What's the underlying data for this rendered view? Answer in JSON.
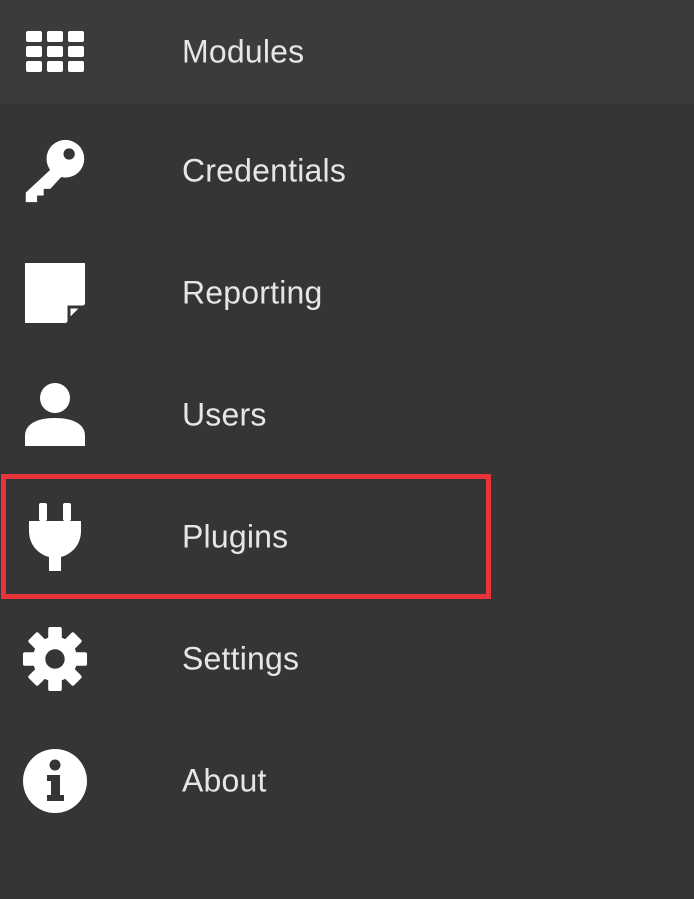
{
  "sidebar": {
    "items": [
      {
        "label": "Modules",
        "icon": "modules-grid-icon"
      },
      {
        "label": "Credentials",
        "icon": "key-icon"
      },
      {
        "label": "Reporting",
        "icon": "note-icon"
      },
      {
        "label": "Users",
        "icon": "user-icon"
      },
      {
        "label": "Plugins",
        "icon": "plug-icon"
      },
      {
        "label": "Settings",
        "icon": "gear-icon"
      },
      {
        "label": "About",
        "icon": "info-icon"
      }
    ],
    "active_item": "Modules",
    "highlighted_item": "Plugins"
  },
  "colors": {
    "background": "#353535",
    "active_background": "#3b3b3b",
    "text": "#e6e6e6",
    "icon": "#ffffff",
    "highlight_border": "#e8343a"
  }
}
